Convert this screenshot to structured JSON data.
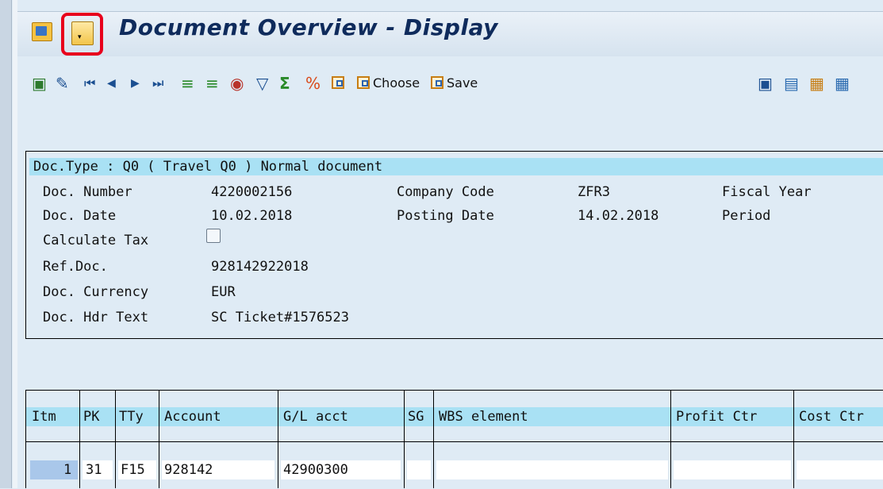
{
  "window": {
    "title": "Document Overview - Display"
  },
  "toolbar": {
    "choose_label": "Choose",
    "save_label": "Save"
  },
  "header": {
    "doc_type_line": "Doc.Type : Q0 ( Travel Q0 ) Normal document",
    "fields": [
      {
        "label": "Doc. Number",
        "value": "4220002156"
      },
      {
        "label": "Company Code",
        "value": "ZFR3"
      },
      {
        "label": "Fiscal Year",
        "value": ""
      },
      {
        "label": "Doc. Date",
        "value": "10.02.2018"
      },
      {
        "label": "Posting Date",
        "value": "14.02.2018"
      },
      {
        "label": "Period",
        "value": ""
      },
      {
        "label": "Calculate Tax",
        "value": ""
      },
      {
        "label": "Ref.Doc.",
        "value": "928142922018"
      },
      {
        "label": "Doc. Currency",
        "value": "EUR"
      },
      {
        "label": "Doc. Hdr Text",
        "value": "SC Ticket#1576523"
      }
    ]
  },
  "table": {
    "columns": [
      "Itm",
      "PK",
      "TTy",
      "Account",
      "G/L acct",
      "SG",
      "WBS element",
      "Profit Ctr",
      "Cost Ctr"
    ],
    "rows": [
      {
        "itm": "1",
        "pk": "31",
        "tty": "F15",
        "account": "928142",
        "gl_acct": "42900300",
        "sg": "",
        "wbs": "",
        "profit_ctr": "",
        "cost_ctr": ""
      }
    ]
  }
}
